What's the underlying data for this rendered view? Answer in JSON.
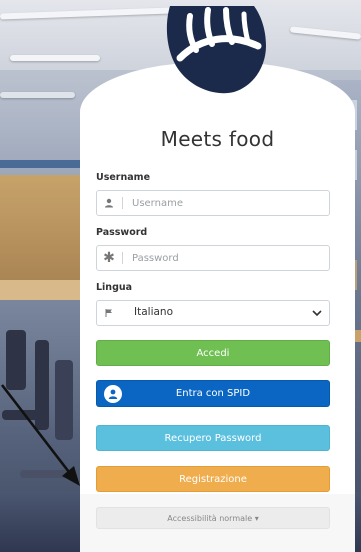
{
  "app": {
    "title": "Meets food"
  },
  "form": {
    "username": {
      "label": "Username",
      "placeholder": "Username",
      "icon": "user-icon"
    },
    "password": {
      "label": "Password",
      "placeholder": "Password",
      "icon": "asterisk-icon"
    },
    "language": {
      "label": "Lingua",
      "selected": "Italiano",
      "icon": "flag-icon"
    }
  },
  "buttons": {
    "login": "Accedi",
    "spid": "Entra con SPID",
    "recover": "Recupero Password",
    "register": "Registrazione"
  },
  "footer": {
    "accessibility": "Accessibilità normale ▾"
  },
  "colors": {
    "login": "#6fbf52",
    "spid": "#0a66c2",
    "recover": "#5bc0de",
    "register": "#f0ad4e",
    "logo": "#1b2a4a"
  }
}
